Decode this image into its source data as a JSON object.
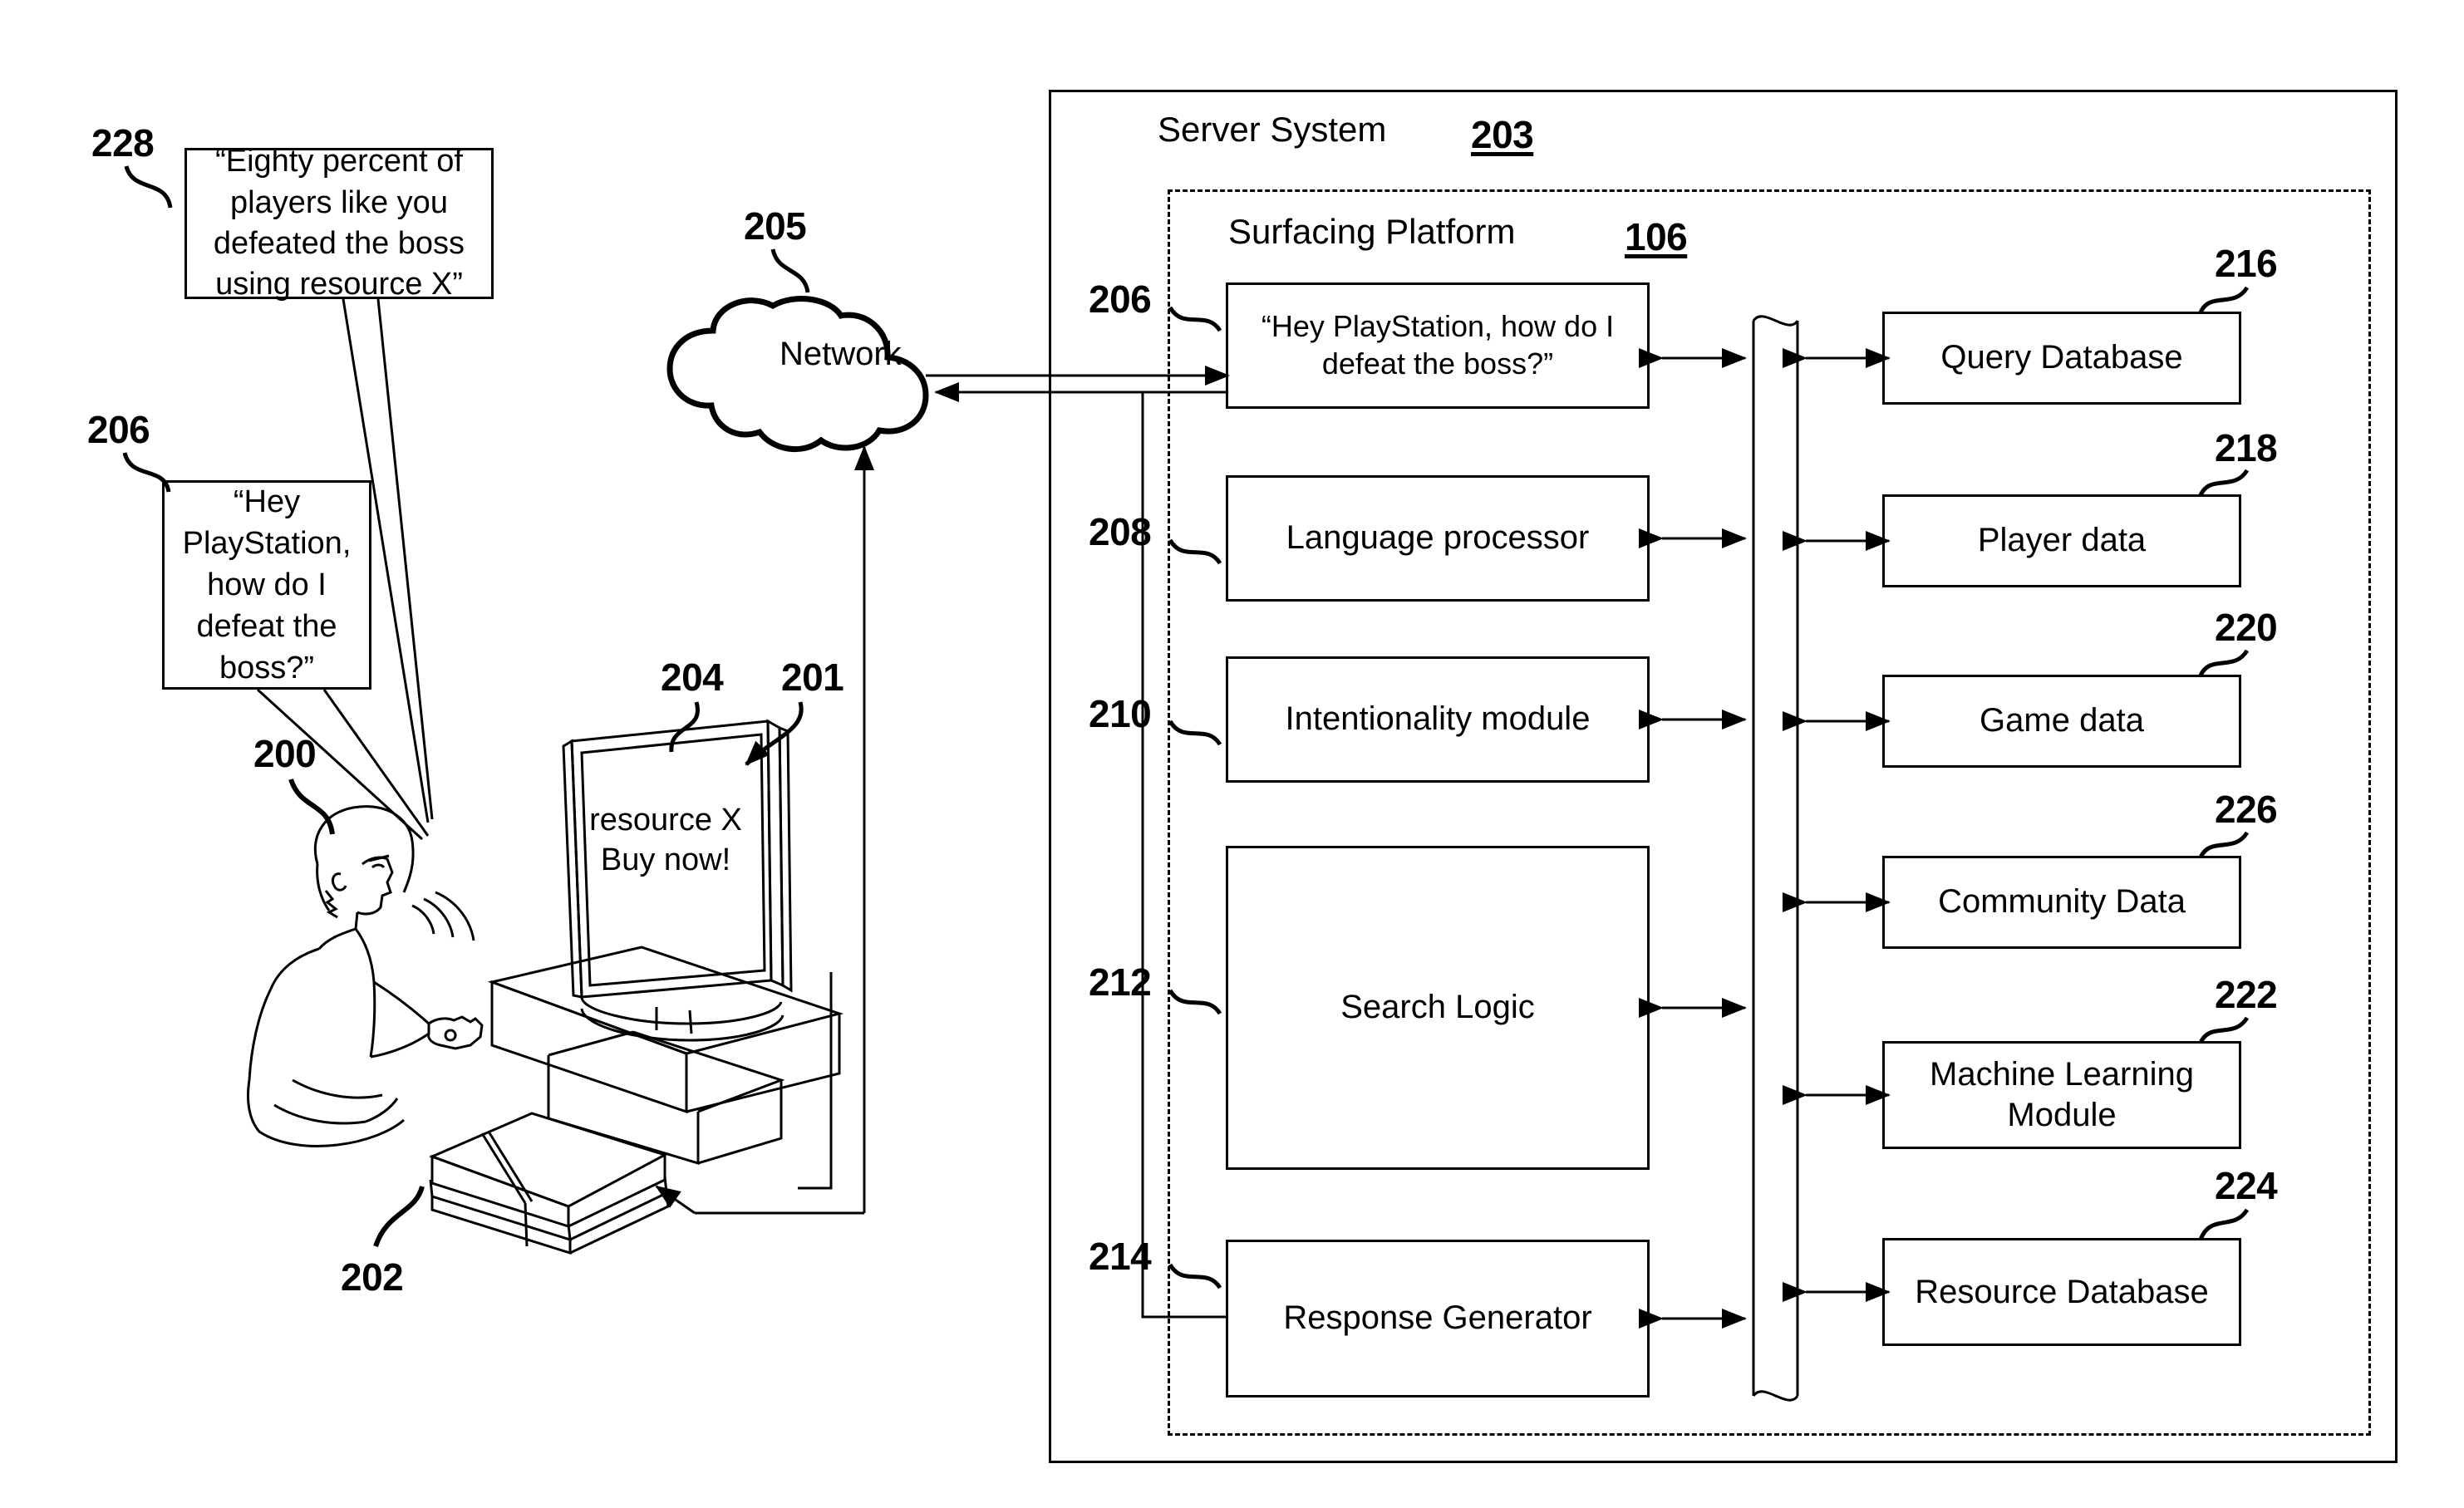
{
  "figure": {
    "type": "patent-diagram",
    "description": "System diagram of a voice query surfacing platform for a game console"
  },
  "left_scene": {
    "response_bubble": {
      "ref": "228",
      "text": "“Eighty percent of players like you defeated the boss using resource X”"
    },
    "query_bubble": {
      "ref": "206",
      "text": "“Hey PlayStation, how do I defeat the boss?”"
    },
    "player": {
      "ref": "200"
    },
    "tv": {
      "ref": "204"
    },
    "tv_screen": {
      "ref": "201",
      "line1": "resource X",
      "line2": "Buy now!"
    },
    "console": {
      "ref": "202"
    }
  },
  "network": {
    "ref": "205",
    "label": "Network"
  },
  "server": {
    "title": "Server System",
    "ref": "203"
  },
  "platform": {
    "title": "Surfacing Platform",
    "ref": "106"
  },
  "modules": [
    {
      "ref": "206",
      "label": "“Hey PlayStation, how do I defeat the boss?”"
    },
    {
      "ref": "208",
      "label": "Language processor"
    },
    {
      "ref": "210",
      "label": "Intentionality module"
    },
    {
      "ref": "212",
      "label": "Search Logic"
    },
    {
      "ref": "214",
      "label": "Response Generator"
    }
  ],
  "data_stores": [
    {
      "ref": "216",
      "label": "Query Database"
    },
    {
      "ref": "218",
      "label": "Player data"
    },
    {
      "ref": "220",
      "label": "Game data"
    },
    {
      "ref": "226",
      "label": "Community Data"
    },
    {
      "ref": "222",
      "label": "Machine Learning Module"
    },
    {
      "ref": "224",
      "label": "Resource Database"
    }
  ],
  "colors": {
    "line": "#000000",
    "background": "#ffffff"
  }
}
